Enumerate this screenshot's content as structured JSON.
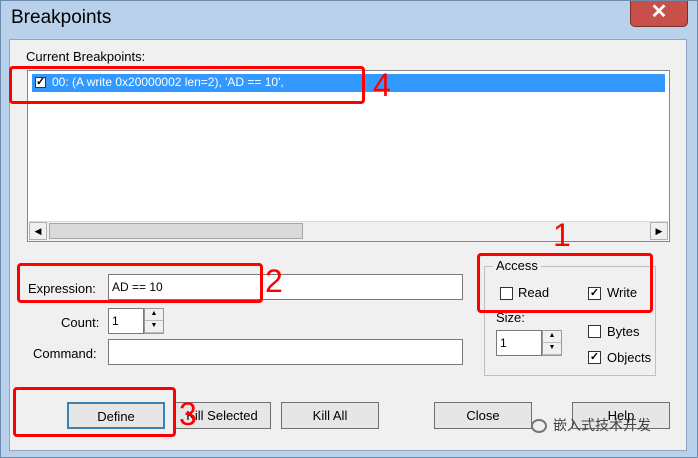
{
  "window": {
    "title": "Breakpoints",
    "close_glyph": "✕"
  },
  "current": {
    "label": "Current Breakpoints:",
    "items": [
      {
        "checked": true,
        "text": "00: (A write 0x20000002 len=2),  'AD == 10',"
      }
    ]
  },
  "expression": {
    "label": "Expression:",
    "value": "AD == 10"
  },
  "count": {
    "label": "Count:",
    "value": "1"
  },
  "command": {
    "label": "Command:",
    "value": ""
  },
  "access": {
    "title": "Access",
    "read_label": "Read",
    "read_checked": false,
    "write_label": "Write",
    "write_checked": true
  },
  "size": {
    "label": "Size:",
    "value": "1"
  },
  "bytes": {
    "label": "Bytes",
    "checked": false
  },
  "objects": {
    "label": "Objects",
    "checked": true
  },
  "buttons": {
    "define": "Define",
    "kill_selected": "Kill Selected",
    "kill_all": "Kill All",
    "close": "Close",
    "help": "Help"
  },
  "annotations": {
    "n1": "1",
    "n2": "2",
    "n3": "3",
    "n4": "4"
  },
  "watermark": "嵌入式技术开发",
  "colors": {
    "annotation": "#ff0000",
    "selection": "#3399ff",
    "titlebar": "#b9d1ea",
    "close": "#c7504a"
  }
}
